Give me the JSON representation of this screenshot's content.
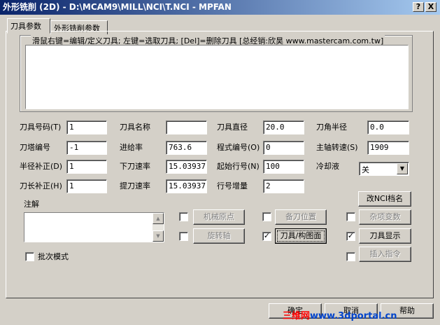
{
  "window": {
    "title": "外形铣削 (2D) - D:\\MCAM9\\MILL\\NCI\\T.NCI - MPFAN",
    "help_btn": "?",
    "close_btn": "X"
  },
  "tabs": [
    {
      "label": "刀具参数"
    },
    {
      "label": "外形铣削参数"
    }
  ],
  "tool_library_hint": "滑鼠右键=编辑/定义刀具; 左键=选取刀具; [Del]=删除刀具 [总经销:欣昊 www.mastercam.com.tw]",
  "fields": {
    "tool_number": {
      "label": "刀具号码(T)",
      "value": "1"
    },
    "tool_name": {
      "label": "刀具名称",
      "value": ""
    },
    "tool_diameter": {
      "label": "刀具直径",
      "value": "20.0"
    },
    "corner_radius": {
      "label": "刀角半径",
      "value": "0.0"
    },
    "turret_number": {
      "label": "刀塔编号",
      "value": "-1"
    },
    "feed_rate": {
      "label": "进给率",
      "value": "763.6"
    },
    "program_number": {
      "label": "程式编号(O)",
      "value": "0"
    },
    "spindle_speed": {
      "label": "主轴转速(S)",
      "value": "1909"
    },
    "radius_comp": {
      "label": "半径补正(D)",
      "value": "1"
    },
    "plunge_rate": {
      "label": "下刀速率",
      "value": "15.03937"
    },
    "start_seq": {
      "label": "起始行号(N)",
      "value": "100"
    },
    "coolant": {
      "label": "冷却液",
      "value": "关"
    },
    "length_comp": {
      "label": "刀长补正(H)",
      "value": "1"
    },
    "retract_rate": {
      "label": "提刀速率",
      "value": "15.03937"
    },
    "seq_increment": {
      "label": "行号增量",
      "value": "2"
    }
  },
  "buttons": {
    "change_nci": "改NCI档名",
    "home_pos": "机械原点",
    "ref_point": "备刀位置",
    "misc_values": "杂项变数",
    "rotary_axis": "旋转轴",
    "tool_plane": "刀具/构图面",
    "tool_display": "刀具显示",
    "insert_cmd": "插入指令",
    "ok": "确定",
    "cancel": "取消",
    "help": "帮助"
  },
  "comment_label": "注解",
  "batch_mode_label": "批次模式",
  "checks": {
    "home_pos": false,
    "ref_point": false,
    "misc_values": false,
    "rotary_axis": false,
    "tool_plane": true,
    "tool_display": true,
    "insert_cmd": false,
    "batch_mode": false
  },
  "check_mark": "✓",
  "watermark": {
    "part1": "三维网",
    "part2": "www.3dportal.cn"
  }
}
